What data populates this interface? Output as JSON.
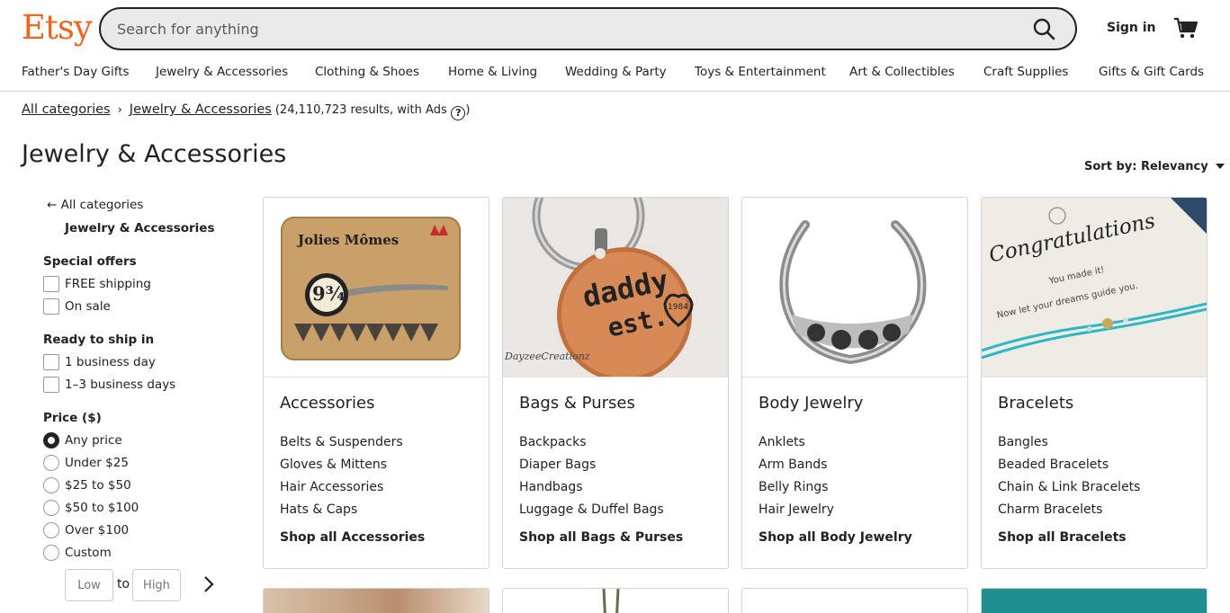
{
  "header": {
    "logo": "Etsy",
    "search_placeholder": "Search for anything",
    "sign_in": "Sign in"
  },
  "nav": [
    "Father's Day Gifts",
    "Jewelry & Accessories",
    "Clothing & Shoes",
    "Home & Living",
    "Wedding & Party",
    "Toys & Entertainment",
    "Art & Collectibles",
    "Craft Supplies",
    "Gifts & Gift Cards"
  ],
  "breadcrumb": {
    "root": "All categories",
    "current": "Jewelry & Accessories",
    "count": "(24,110,723 results, with Ads",
    "count_close": ")",
    "help": "?"
  },
  "page_title": "Jewelry & Accessories",
  "sort": {
    "label": "Sort by: Relevancy"
  },
  "sidebar": {
    "back": "All categories",
    "current": "Jewelry & Accessories",
    "special_offers": {
      "heading": "Special offers",
      "options": [
        "FREE shipping",
        "On sale"
      ]
    },
    "ready_to_ship": {
      "heading": "Ready to ship in",
      "options": [
        "1 business day",
        "1–3 business days"
      ]
    },
    "price": {
      "heading": "Price ($)",
      "options": [
        "Any price",
        "Under $25",
        "$25 to $50",
        "$50 to $100",
        "Over $100",
        "Custom"
      ],
      "selected": "Any price",
      "low_placeholder": "Low",
      "to": "to",
      "high_placeholder": "High"
    }
  },
  "categories": [
    {
      "title": "Accessories",
      "links": [
        "Belts & Suspenders",
        "Gloves & Mittens",
        "Hair Accessories",
        "Hats & Caps"
      ],
      "shop_all": "Shop all Accessories",
      "image": {
        "text_top": "Jolies Mômes",
        "text_badge": "9¾"
      }
    },
    {
      "title": "Bags & Purses",
      "links": [
        "Backpacks",
        "Diaper Bags",
        "Handbags",
        "Luggage & Duffel Bags"
      ],
      "shop_all": "Shop all Bags & Purses",
      "image": {
        "text_main": "daddy",
        "text_sub": "est.",
        "text_year": "1984",
        "watermark": "DayzeeCreationz"
      }
    },
    {
      "title": "Body Jewelry",
      "links": [
        "Anklets",
        "Arm Bands",
        "Belly Rings",
        "Hair Jewelry"
      ],
      "shop_all": "Shop all Body Jewelry",
      "image": {}
    },
    {
      "title": "Bracelets",
      "links": [
        "Bangles",
        "Beaded Bracelets",
        "Chain & Link Bracelets",
        "Charm Bracelets"
      ],
      "shop_all": "Shop all Bracelets",
      "image": {
        "text_main": "Congratulations",
        "text_sub1": "You made it!",
        "text_sub2": "Now let your dreams guide you."
      }
    }
  ],
  "colors": {
    "brand": "#F1641E",
    "text": "#222222",
    "border": "#d4d4d4"
  }
}
